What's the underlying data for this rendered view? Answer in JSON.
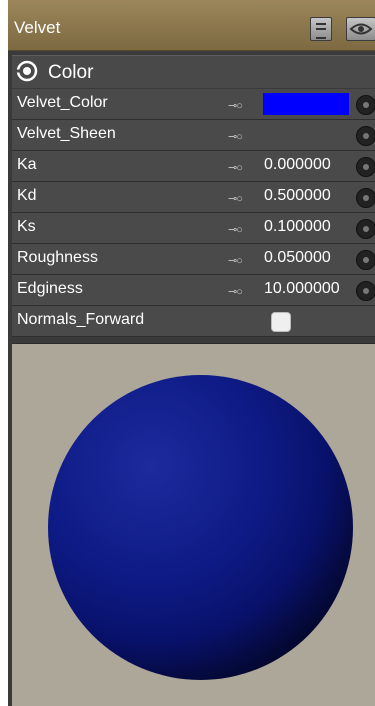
{
  "window": {
    "title": "Velvet"
  },
  "section": {
    "label": "Color"
  },
  "params": [
    {
      "name": "Velvet_Color",
      "key": "⊸○",
      "type": "color",
      "color": "#0000ff"
    },
    {
      "name": "Velvet_Sheen",
      "key": "⊸○",
      "type": "color",
      "color": "#4a4a4a"
    },
    {
      "name": "Ka",
      "key": "⊸○",
      "type": "number",
      "value": "0.000000"
    },
    {
      "name": "Kd",
      "key": "⊸○",
      "type": "number",
      "value": "0.500000"
    },
    {
      "name": "Ks",
      "key": "⊸○",
      "type": "number",
      "value": "0.100000"
    },
    {
      "name": "Roughness",
      "key": "⊸○",
      "type": "number",
      "value": "0.050000"
    },
    {
      "name": "Edginess",
      "key": "⊸○",
      "type": "number",
      "value": "10.000000"
    },
    {
      "name": "Normals_Forward",
      "type": "checkbox",
      "checked": false
    }
  ],
  "icons": {
    "titlebar": [
      "list-view-icon",
      "eye-icon"
    ],
    "section": "eye-toggle-icon",
    "row_button": "connect-node-icon"
  },
  "preview": {
    "sphere_color": "#0e1b86"
  }
}
